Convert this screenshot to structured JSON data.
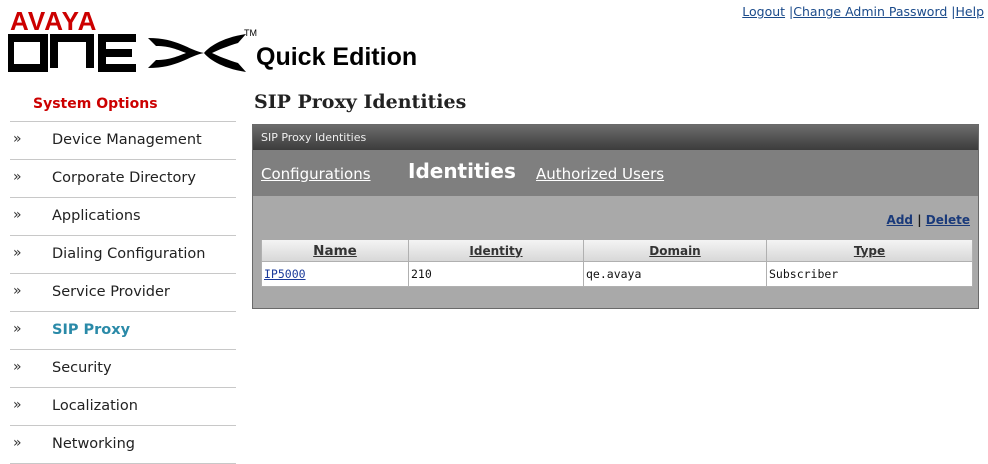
{
  "logo": {
    "brand": "AVAYA",
    "product": "one-X",
    "trademark": "TM",
    "edition": "Quick Edition",
    "brand_color": "#cc0000"
  },
  "top_links": {
    "logout": "Logout",
    "sep1": "|",
    "change_password": "Change Admin Password",
    "sep2": "|",
    "help": "Help"
  },
  "sidebar": {
    "title": "System Options",
    "chevron": "»",
    "items": [
      {
        "label": "Device Management"
      },
      {
        "label": "Corporate Directory"
      },
      {
        "label": "Applications"
      },
      {
        "label": "Dialing Configuration"
      },
      {
        "label": "Service Provider"
      },
      {
        "label": "SIP Proxy",
        "active": true
      },
      {
        "label": "Security"
      },
      {
        "label": "Localization"
      },
      {
        "label": "Networking"
      }
    ]
  },
  "main": {
    "title": "SIP Proxy Identities",
    "panel_title": "SIP Proxy Identities",
    "tabs": {
      "configurations": "Configurations",
      "identities": "Identities",
      "authorized_users": "Authorized Users"
    },
    "actions": {
      "add": "Add",
      "sep": "|",
      "delete": "Delete"
    },
    "table": {
      "columns": [
        "Name",
        "Identity",
        "Domain",
        "Type"
      ],
      "rows": [
        {
          "name": "IP5000",
          "identity": "210",
          "domain": "qe.avaya",
          "type": "Subscriber"
        }
      ]
    }
  }
}
